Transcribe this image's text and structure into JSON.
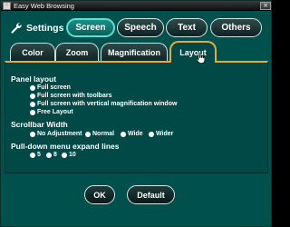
{
  "window": {
    "title": "Easy Web Browsing",
    "close_symbol": "×"
  },
  "header": {
    "settings_label": "Settings",
    "categories": [
      {
        "label": "Screen",
        "active": true
      },
      {
        "label": "Speech",
        "active": false
      },
      {
        "label": "Text",
        "active": false
      },
      {
        "label": "Others",
        "active": false
      }
    ]
  },
  "tabs": [
    {
      "label": "Color",
      "active": false
    },
    {
      "label": "Zoom",
      "active": false
    },
    {
      "label": "Magnification",
      "active": false
    },
    {
      "label": "Layout",
      "active": true
    }
  ],
  "panel": {
    "panel_layout": {
      "label": "Panel layout",
      "options": [
        {
          "label": "Full screen",
          "checked": false
        },
        {
          "label": "Full screen with toolbars",
          "checked": false
        },
        {
          "label": "Full screen with vertical magnification window",
          "checked": false
        },
        {
          "label": "Free Layout",
          "checked": false
        }
      ]
    },
    "scrollbar_width": {
      "label": "Scrollbar Width",
      "options": [
        {
          "label": "No Adjustment",
          "checked": false
        },
        {
          "label": "Normal",
          "checked": false
        },
        {
          "label": "Wide",
          "checked": false
        },
        {
          "label": "Wider",
          "checked": false
        }
      ]
    },
    "pulldown_lines": {
      "label": "Pull-down menu expand lines",
      "options": [
        {
          "label": "5",
          "checked": false
        },
        {
          "label": "8",
          "checked": false
        },
        {
          "label": "10",
          "checked": false
        }
      ]
    }
  },
  "footer": {
    "ok_label": "OK",
    "default_label": "Default"
  },
  "colors": {
    "background": "#00514d",
    "panel": "#004946",
    "active_tab_border": "#e3a93a",
    "active_category": "#1b8e88"
  }
}
